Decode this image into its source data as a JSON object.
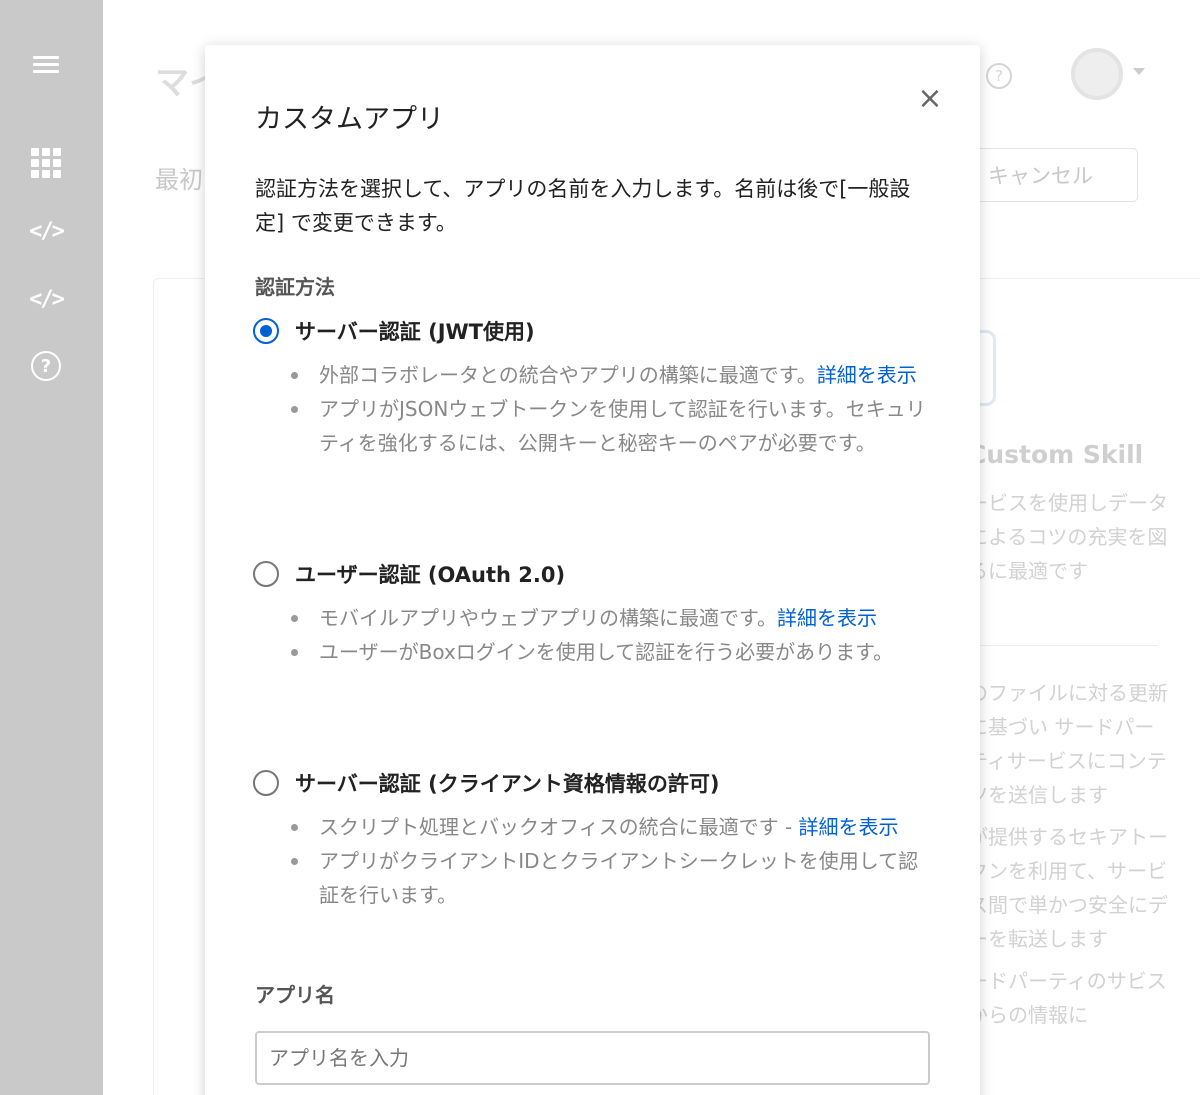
{
  "sidebar": {
    "icons": [
      "menu-icon",
      "apps-grid-icon",
      "code-icon",
      "code-icon",
      "help-icon"
    ],
    "code_glyph": "</>",
    "help_glyph": "?"
  },
  "background": {
    "title": "マイ",
    "subtitle": "最初",
    "help_glyph": "?",
    "cancel_label": "キャンセル",
    "skill_title": "Custom Skill",
    "skill_desc": "ービスを使用しデータによるコツの充実を図るに最適です",
    "list": [
      "のファイルに対る更新に基づい サードパーティサービスにコンテツを送信します",
      "が提供するセキアトークンを利用て、サービス間で単かつ安全にデーを転送します",
      "ードパーティのサビスからの情報に"
    ]
  },
  "modal": {
    "title": "カスタムアプリ",
    "intro": "認証方法を選択して、アプリの名前を入力します。名前は後で[一般設定] で変更できます。",
    "auth_label": "認証方法",
    "options": [
      {
        "title": "サーバー認証 (JWT使用)",
        "checked": true,
        "bullets": [
          {
            "text": "外部コラボレータとの統合やアプリの構築に最適です。",
            "link": "詳細を表示"
          },
          {
            "text": "アプリがJSONウェブトークンを使用して認証を行います。セキュリティを強化するには、公開キーと秘密キーのペアが必要です。",
            "link": ""
          }
        ]
      },
      {
        "title": "ユーザー認証 (OAuth 2.0)",
        "checked": false,
        "bullets": [
          {
            "text": "モバイルアプリやウェブアプリの構築に最適です。",
            "link": "詳細を表示"
          },
          {
            "text": "ユーザーがBoxログインを使用して認証を行う必要があります。",
            "link": ""
          }
        ]
      },
      {
        "title": "サーバー認証 (クライアント資格情報の許可)",
        "checked": false,
        "bullets": [
          {
            "text": "スクリプト処理とバックオフィスの統合に最適です - ",
            "link": "詳細を表示"
          },
          {
            "text": "アプリがクライアントIDとクライアントシークレットを使用して認証を行います。",
            "link": ""
          }
        ]
      }
    ],
    "app_name_label": "アプリ名",
    "app_name_placeholder": "アプリ名を入力",
    "app_name_value": "",
    "close_glyph": "×"
  },
  "colors": {
    "accent": "#0061d5",
    "sidebar": "#c9c9c9"
  }
}
